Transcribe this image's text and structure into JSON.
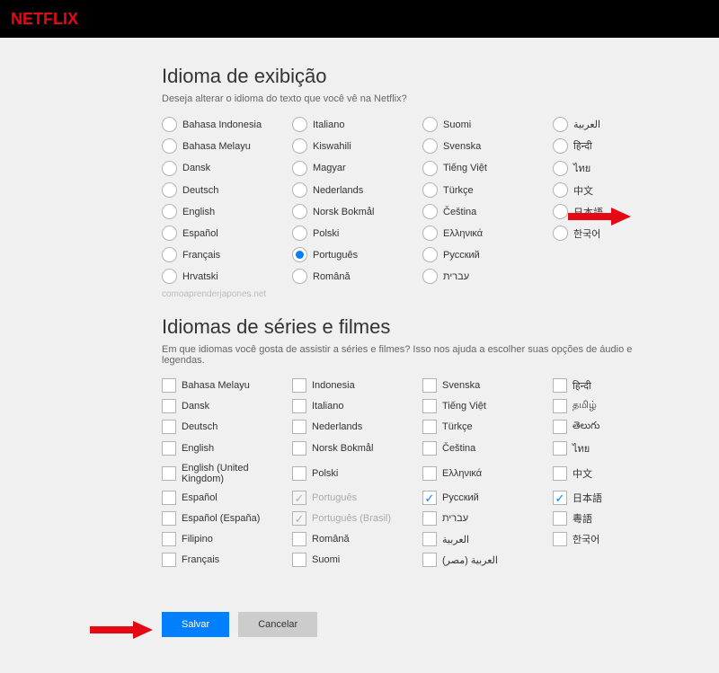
{
  "header": {
    "logo": "NETFLIX"
  },
  "display_language": {
    "title": "Idioma de exibição",
    "desc": "Deseja alterar o idioma do texto que você vê na Netflix?",
    "selected": "Português",
    "options": [
      "Bahasa Indonesia",
      "Bahasa Melayu",
      "Dansk",
      "Deutsch",
      "English",
      "Español",
      "Français",
      "Hrvatski",
      "Italiano",
      "Kiswahili",
      "Magyar",
      "Nederlands",
      "Norsk Bokmål",
      "Polski",
      "Português",
      "Română",
      "Suomi",
      "Svenska",
      "Tiếng Việt",
      "Türkçe",
      "Čeština",
      "Ελληνικά",
      "Русский",
      "עברית",
      "العربية",
      "हिन्दी",
      "ไทย",
      "中文",
      "日本語",
      "한국어"
    ]
  },
  "watermark": "comoaprenderjapones.net",
  "content_language": {
    "title": "Idiomas de séries e filmes",
    "desc": "Em que idiomas você gosta de assistir a séries e filmes? Isso nos ajuda a escolher suas opções de áudio e legendas.",
    "options": [
      {
        "label": "Bahasa Melayu",
        "checked": false,
        "disabled": false
      },
      {
        "label": "Dansk",
        "checked": false,
        "disabled": false
      },
      {
        "label": "Deutsch",
        "checked": false,
        "disabled": false
      },
      {
        "label": "English",
        "checked": false,
        "disabled": false
      },
      {
        "label": "English (United Kingdom)",
        "checked": false,
        "disabled": false
      },
      {
        "label": "Español",
        "checked": false,
        "disabled": false
      },
      {
        "label": "Español (España)",
        "checked": false,
        "disabled": false
      },
      {
        "label": "Filipino",
        "checked": false,
        "disabled": false
      },
      {
        "label": "Français",
        "checked": false,
        "disabled": false
      },
      {
        "label": "Indonesia",
        "checked": false,
        "disabled": false
      },
      {
        "label": "Italiano",
        "checked": false,
        "disabled": false
      },
      {
        "label": "Nederlands",
        "checked": false,
        "disabled": false
      },
      {
        "label": "Norsk Bokmål",
        "checked": false,
        "disabled": false
      },
      {
        "label": "Polski",
        "checked": false,
        "disabled": false
      },
      {
        "label": "Português",
        "checked": true,
        "disabled": true
      },
      {
        "label": "Português (Brasil)",
        "checked": true,
        "disabled": true
      },
      {
        "label": "Română",
        "checked": false,
        "disabled": false
      },
      {
        "label": "Suomi",
        "checked": false,
        "disabled": false
      },
      {
        "label": "Svenska",
        "checked": false,
        "disabled": false
      },
      {
        "label": "Tiếng Việt",
        "checked": false,
        "disabled": false
      },
      {
        "label": "Türkçe",
        "checked": false,
        "disabled": false
      },
      {
        "label": "Čeština",
        "checked": false,
        "disabled": false
      },
      {
        "label": "Ελληνικά",
        "checked": false,
        "disabled": false
      },
      {
        "label": "Русский",
        "checked": true,
        "disabled": false
      },
      {
        "label": "עברית",
        "checked": false,
        "disabled": false
      },
      {
        "label": "العربية",
        "checked": false,
        "disabled": false
      },
      {
        "label": "العربية (مصر)",
        "checked": false,
        "disabled": false
      },
      {
        "label": "हिन्दी",
        "checked": false,
        "disabled": false
      },
      {
        "label": "தமிழ்",
        "checked": false,
        "disabled": false
      },
      {
        "label": "తెలుగు",
        "checked": false,
        "disabled": false
      },
      {
        "label": "ไทย",
        "checked": false,
        "disabled": false
      },
      {
        "label": "中文",
        "checked": false,
        "disabled": false
      },
      {
        "label": "日本語",
        "checked": true,
        "disabled": false
      },
      {
        "label": "粵語",
        "checked": false,
        "disabled": false
      },
      {
        "label": "한국어",
        "checked": false,
        "disabled": false
      }
    ]
  },
  "buttons": {
    "save": "Salvar",
    "cancel": "Cancelar"
  }
}
